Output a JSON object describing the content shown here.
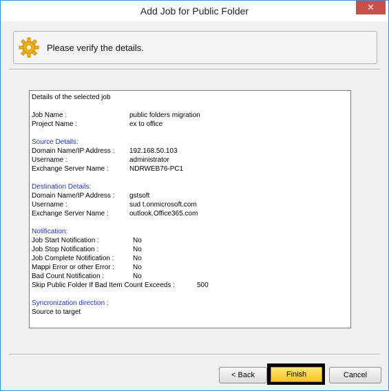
{
  "window": {
    "title": "Add Job for Public Folder",
    "close_icon": "close-icon"
  },
  "header": {
    "message": "Please verify the details.",
    "icon": "gear-icon"
  },
  "details": {
    "heading": "Details of the selected job",
    "job_name_label": "Job Name :",
    "job_name_value": "public folders migration",
    "project_name_label": "Project Name :",
    "project_name_value": "ex to office",
    "source_heading": "Source Details:",
    "src_domain_label": "Domain Name/IP Address :",
    "src_domain_value": "192.168.50.103",
    "src_user_label": "Username :",
    "src_user_value": "administrator",
    "src_server_label": "Exchange Server Name :",
    "src_server_value": "NDRWEB76-PC1",
    "dest_heading": "Destination Details:",
    "dst_domain_label": "Domain Name/IP Address :",
    "dst_domain_value": "gstsoft",
    "dst_user_label": "Username :",
    "dst_user_value": "sud        t.onmicrosoft.com",
    "dst_server_label": "Exchange Server Name :",
    "dst_server_value": "outlook.Office365.com",
    "notif_heading": "Notification:",
    "n1_label": "Job Start Notification :",
    "n1_value": "No",
    "n2_label": "Job Stop Notification :",
    "n2_value": "No",
    "n3_label": "Job Complete Notification :",
    "n3_value": "No",
    "n4_label": "Mappi Error or other Error :",
    "n4_value": "No",
    "n5_label": "Bad Count Notification :",
    "n5_value": "No",
    "n6_label": "Skip Public Folder If Bad Item Count Exceeds :",
    "n6_value": "500",
    "sync_heading": "Syncronization direction :",
    "sync_value": "Source to target"
  },
  "buttons": {
    "back": "< Back",
    "finish": "Finish",
    "cancel": "Cancel"
  }
}
